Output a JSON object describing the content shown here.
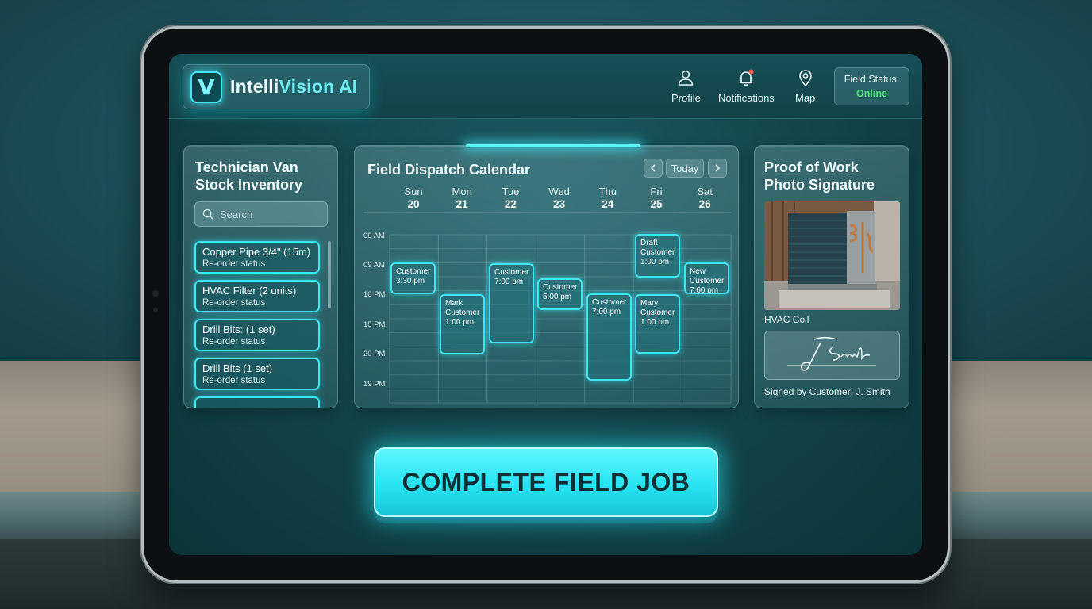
{
  "app": {
    "name_main": "Intelli",
    "name_accent": "Vision AI",
    "logo_letter": "V"
  },
  "header": {
    "nav": [
      {
        "label": "Profile",
        "icon": "user-icon"
      },
      {
        "label": "Notifications",
        "icon": "bell-icon"
      },
      {
        "label": "Map",
        "icon": "map-pin-icon"
      }
    ],
    "status_label": "Field Status:",
    "status_value": "Online"
  },
  "inventory": {
    "title": "Technician Van Stock Inventory",
    "search_placeholder": "Search",
    "items": [
      {
        "name": "Copper Pipe 3/4\" (15m)",
        "status": "Re-order status"
      },
      {
        "name": "HVAC Filter (2 units)",
        "status": "Re-order status"
      },
      {
        "name": "Drill Bits: (1 set)",
        "status": "Re-order status"
      },
      {
        "name": "Drill Bits (1 set)",
        "status": "Re-order status"
      }
    ]
  },
  "calendar": {
    "title": "Field Dispatch Calendar",
    "today_label": "Today",
    "prev_icon": "chevron-left-icon",
    "next_icon": "chevron-right-icon",
    "days": [
      {
        "name": "Sun",
        "date": "20"
      },
      {
        "name": "Mon",
        "date": "21"
      },
      {
        "name": "Tue",
        "date": "22"
      },
      {
        "name": "Wed",
        "date": "23"
      },
      {
        "name": "Thu",
        "date": "24"
      },
      {
        "name": "Fri",
        "date": "25"
      },
      {
        "name": "Sat",
        "date": "26"
      }
    ],
    "time_labels": [
      "09 AM",
      "09 AM",
      "10 PM",
      "15 PM",
      "20 PM",
      "19 PM"
    ],
    "events": [
      {
        "day": 0,
        "lines": [
          "Customer",
          "3:30 pm"
        ]
      },
      {
        "day": 1,
        "lines": [
          "Mark",
          "Customer",
          "1:00 pm"
        ]
      },
      {
        "day": 2,
        "lines": [
          "Customer",
          "7:00 pm"
        ]
      },
      {
        "day": 3,
        "lines": [
          "Customer",
          "5:00 pm"
        ]
      },
      {
        "day": 4,
        "lines": [
          "Customer",
          "7:00 pm"
        ]
      },
      {
        "day": 5,
        "lines": [
          "Draft",
          "Customer",
          "1:00 pm"
        ]
      },
      {
        "day": 5,
        "lines": [
          "Mary",
          "Customer",
          "1:00 pm"
        ]
      },
      {
        "day": 6,
        "lines": [
          "New",
          "Customer",
          "7:60 pm"
        ]
      }
    ]
  },
  "proof": {
    "title": "Proof of Work Photo Signature",
    "photo_caption": "HVAC Coil",
    "signature_text": "J. Smith",
    "signed_by": "Signed by Customer: J. Smith"
  },
  "cta": {
    "label": "COMPLETE FIELD JOB"
  },
  "colors": {
    "accent": "#3ce6f2",
    "online": "#4ee07a",
    "cta_text": "#0f2f35"
  }
}
